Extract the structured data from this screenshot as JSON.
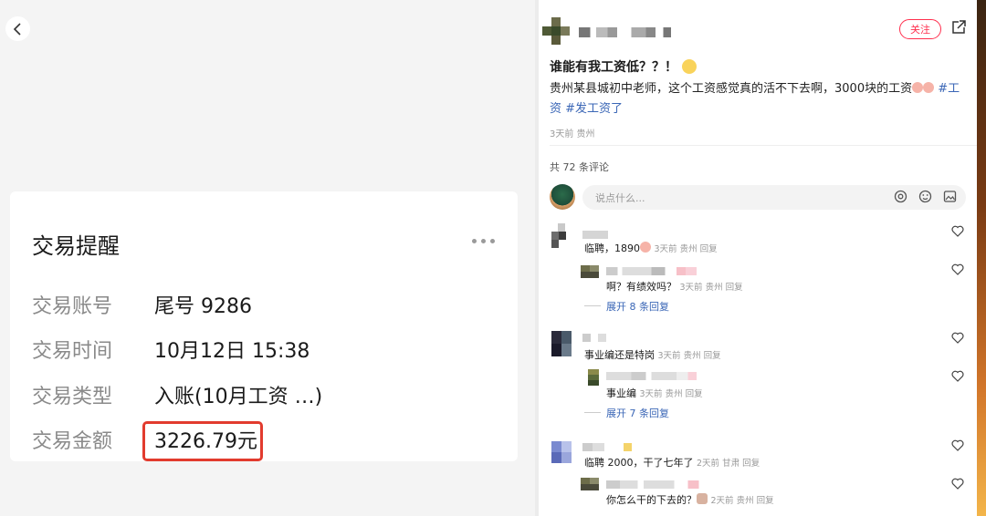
{
  "left_panel": {
    "card": {
      "title": "交易提醒",
      "rows": [
        {
          "label": "交易账号",
          "value": "尾号 9286"
        },
        {
          "label": "交易时间",
          "value": "10月12日 15:38"
        },
        {
          "label": "交易类型",
          "value": "入账(10月工资          …)"
        },
        {
          "label": "交易金额",
          "value": "3226.79元"
        }
      ]
    }
  },
  "right_panel": {
    "follow_label": "关注",
    "post": {
      "title": "谁能有我工资低？？！",
      "body": "贵州某县城初中老师，这个工资感觉真的活不下去啊，3000块的工资",
      "tags": [
        "#工资",
        "#发工资了"
      ],
      "meta": "3天前 贵州"
    },
    "comment_count": "共 72 条评论",
    "comment_placeholder": "说点什么...",
    "comments": [
      {
        "text": "临聘，1890",
        "meta": "3天前 贵州 回复"
      },
      {
        "text": "啊？有绩效吗？",
        "meta": "3天前 贵州 回复",
        "reply": true
      },
      {
        "expand": "展开 8 条回复"
      },
      {
        "text": "事业编还是特岗",
        "meta": "3天前 贵州 回复"
      },
      {
        "text": "事业编",
        "meta": "3天前 贵州 回复",
        "reply": true
      },
      {
        "expand": "展开 7 条回复"
      },
      {
        "text": "临聘 2000，干了七年了",
        "meta": "2天前 甘肃 回复"
      },
      {
        "text": "你怎么干的下去的？",
        "meta": "2天前 贵州 回复",
        "reply": true
      }
    ]
  },
  "colors": {
    "highlight_red": "#e23b2e",
    "follow_red": "#ff2e4d",
    "link_blue": "#3a66b6"
  }
}
